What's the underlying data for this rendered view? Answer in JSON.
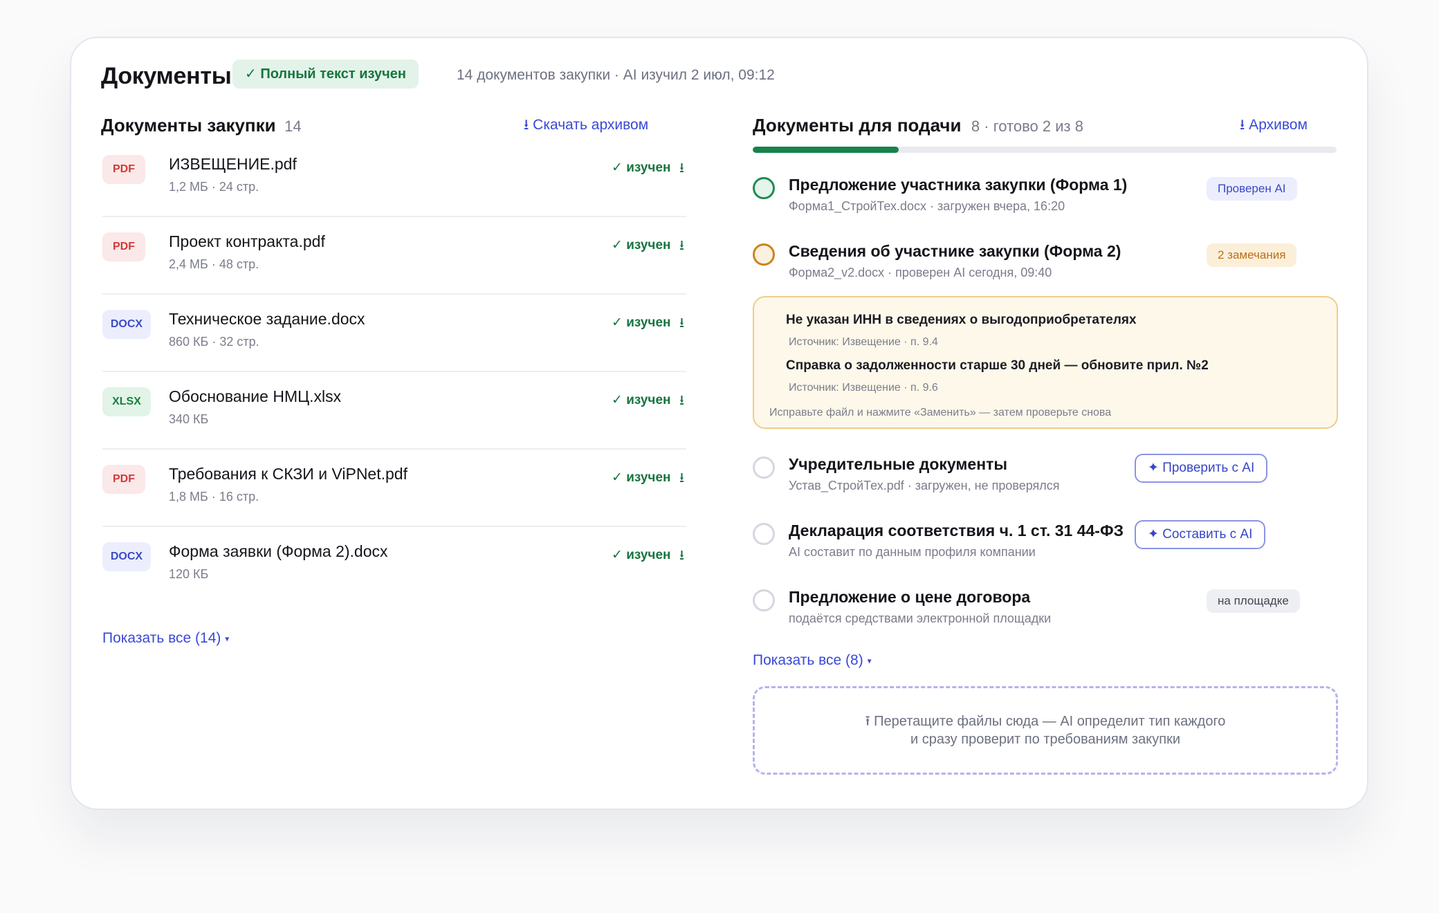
{
  "header": {
    "title": "Документы",
    "status_pill": "✓ Полный текст изучен",
    "meta": "14 документов закупки · AI изучил 2 июл, 09:12"
  },
  "procurement": {
    "title": "Документы закупки",
    "count": "14",
    "download_link": "⭳ Скачать архивом",
    "status_label": "✓ изучен",
    "download_icon": "⭳",
    "files": [
      {
        "type": "PDF",
        "name": "ИЗВЕЩЕНИЕ.pdf",
        "meta": "1,2 МБ · 24 стр."
      },
      {
        "type": "PDF",
        "name": "Проект контракта.pdf",
        "meta": "2,4 МБ · 48 стр."
      },
      {
        "type": "DOCX",
        "name": "Техническое задание.docx",
        "meta": "860 КБ · 32 стр."
      },
      {
        "type": "XLSX",
        "name": "Обоснование НМЦ.xlsx",
        "meta": "340 КБ"
      },
      {
        "type": "PDF",
        "name": "Требования к СКЗИ и ViPNet.pdf",
        "meta": "1,8 МБ · 16 стр."
      },
      {
        "type": "DOCX",
        "name": "Форма заявки (Форма 2).docx",
        "meta": "120 КБ"
      }
    ],
    "show_all": "Показать все (14)",
    "caret": "▾"
  },
  "submission": {
    "title": "Документы для подачи",
    "count": "8 · готово 2 из 8",
    "archive_link": "⭳ Архивом",
    "progress": 0.25,
    "items": [
      {
        "state": "done",
        "title": "Предложение участника закупки (Форма 1)",
        "sub": "Форма1_СтройТех.docx · загружен вчера, 16:20",
        "tag": "Проверен AI"
      },
      {
        "state": "warn",
        "title": "Сведения об участнике закупки (Форма 2)",
        "sub": "Форма2_v2.docx · проверен AI сегодня, 09:40",
        "tag": "2 замечания"
      },
      {
        "state": "empty",
        "title": "Учредительные документы",
        "sub": "Устав_СтройТех.pdf · загружен, не проверялся",
        "button": "✦ Проверить с AI"
      },
      {
        "state": "empty",
        "title": "Декларация соответствия ч. 1 ст. 31 44-ФЗ",
        "sub": "AI составит по данным профиля компании",
        "button": "✦ Составить с AI"
      },
      {
        "state": "empty",
        "title": "Предложение о цене договора",
        "sub": "подаётся средствами электронной площадки",
        "tag": "на площадке"
      }
    ],
    "issues": [
      {
        "title": "Не указан ИНН в сведениях о выгодоприобретателях",
        "source": "Источник: Извещение · п. 9.4"
      },
      {
        "title": "Справка о задолженности старше 30 дней — обновите прил. №2",
        "source": "Источник: Извещение · п. 9.6"
      }
    ],
    "issues_hint": "Исправьте файл и нажмите «Заменить» — затем проверьте снова",
    "show_all": "Показать все (8)",
    "caret": "▾",
    "dropzone_line1": "⭱ Перетащите файлы сюда — AI определит тип каждого",
    "dropzone_line2": "и сразу проверит по требованиям закупки"
  },
  "colors": {
    "accent": "#3949d6",
    "success": "#17753f",
    "warning": "#c9851c",
    "progress": "#16844c"
  }
}
